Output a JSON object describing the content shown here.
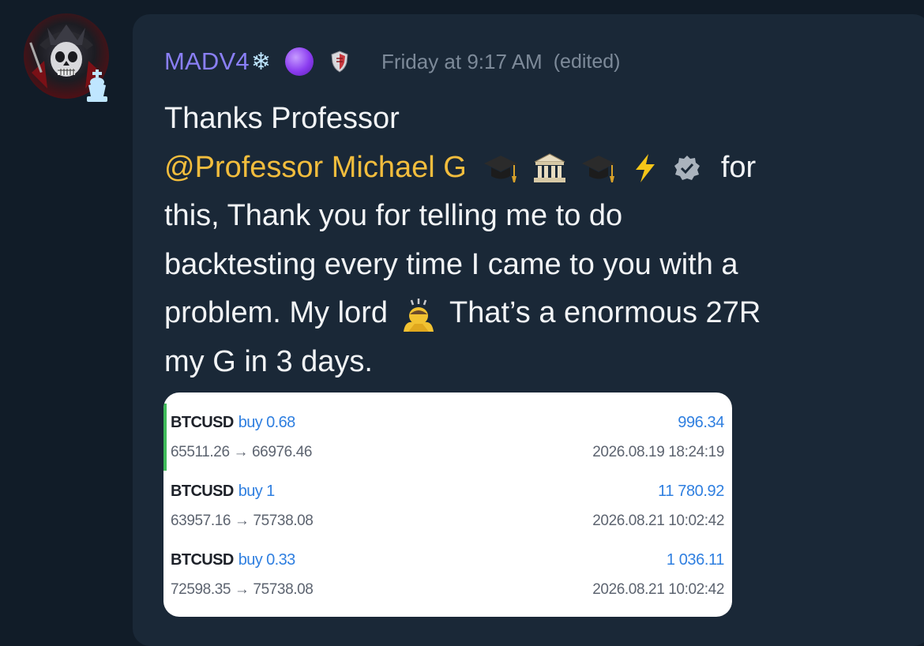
{
  "author": {
    "name": "MADV4",
    "snowflake": "❄",
    "timestamp": "Friday at 9:17 AM",
    "edited": "(edited)"
  },
  "message": {
    "line1": "Thanks Professor",
    "mention": "@Professor Michael G",
    "mention_after": "for",
    "line3": "this, Thank you for telling me to do",
    "line4": "backtesting every time I came to you with a",
    "line5_pre": "problem. My lord",
    "line5_post": "That’s a enormous 27R",
    "line6": "my G in 3 days."
  },
  "trades": [
    {
      "symbol": "BTCUSD",
      "side": "buy 0.68",
      "prices": "65511.26 → 66976.46",
      "profit": "996.34",
      "date": "2026.08.19 18:24:19"
    },
    {
      "symbol": "BTCUSD",
      "side": "buy 1",
      "prices": "63957.16 → 75738.08",
      "profit": "11 780.92",
      "date": "2026.08.21 10:02:42"
    },
    {
      "symbol": "BTCUSD",
      "side": "buy 0.33",
      "prices": "72598.35 → 75738.08",
      "profit": "1 036.11",
      "date": "2026.08.21 10:02:42"
    }
  ],
  "icons": [
    "avatar-samurai-skull",
    "king-chess-icon",
    "snowflake-icon",
    "purple-circle-icon",
    "shield-badge-icon",
    "graduation-cap-icon",
    "classical-building-icon",
    "lightning-icon",
    "verified-badge-icon",
    "bowing-person-icon"
  ],
  "colors": {
    "background": "#111c28",
    "bubble": "#1a2837",
    "username": "#8a7ff5",
    "mention": "#f2bd3d",
    "profit": "#2f7fe0"
  }
}
